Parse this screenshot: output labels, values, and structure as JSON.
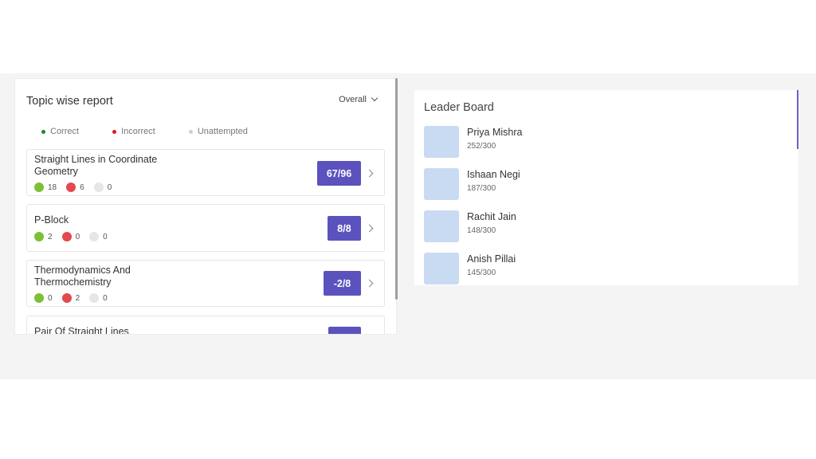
{
  "topic_report": {
    "title": "Topic wise report",
    "filter_label": "Overall",
    "legend": [
      {
        "label": "Correct",
        "color": "#1a8a1a"
      },
      {
        "label": "Incorrect",
        "color": "#d81b1b"
      },
      {
        "label": "Unattempted",
        "color": "#cfcfcf"
      }
    ],
    "stat_colors": {
      "correct": "#7cc035",
      "incorrect": "#e5484d",
      "unattempted": "#e6e6e6"
    },
    "topics": [
      {
        "name": "Straight Lines in Coordinate Geometry",
        "correct": "18",
        "incorrect": "6",
        "unattempted": "0",
        "score": "67/96"
      },
      {
        "name": "P-Block",
        "correct": "2",
        "incorrect": "0",
        "unattempted": "0",
        "score": "8/8"
      },
      {
        "name": "Thermodynamics And Thermochemistry",
        "correct": "0",
        "incorrect": "2",
        "unattempted": "0",
        "score": "-2/8"
      },
      {
        "name": "Pair Of Straight Lines",
        "correct": "",
        "incorrect": "",
        "unattempted": "",
        "score": ""
      }
    ]
  },
  "leader_board": {
    "title": "Leader Board",
    "entries": [
      {
        "name": "Priya Mishra",
        "score": "252/300"
      },
      {
        "name": "Ishaan Negi",
        "score": "187/300"
      },
      {
        "name": "Rachit Jain",
        "score": "148/300"
      },
      {
        "name": "Anish Pillai",
        "score": "145/300"
      }
    ]
  }
}
